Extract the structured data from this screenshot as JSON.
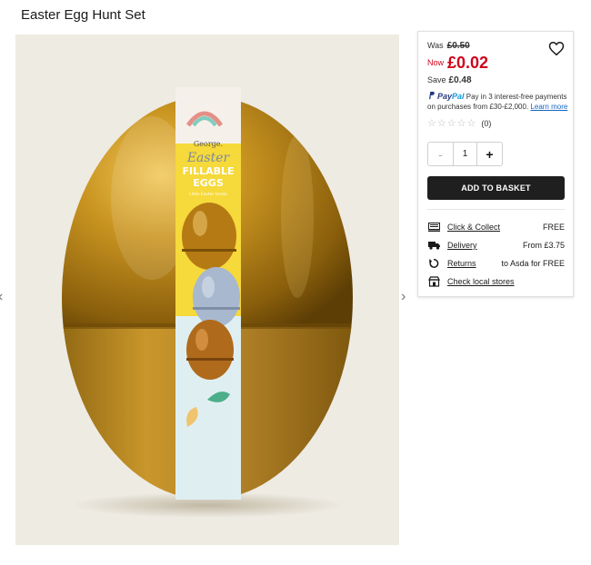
{
  "product": {
    "title": "Easter Egg Hunt Set",
    "image_alt": "Easter Egg Hunt Set",
    "packaging": {
      "brand": "George.",
      "line1": "Easter",
      "line2": "FILLABLE",
      "line3": "EGGS",
      "tagline": "Little Easter treats"
    }
  },
  "gallery": {
    "prev_icon": "chevron-left-icon",
    "next_icon": "chevron-right-icon"
  },
  "pricing": {
    "was_label": "Was",
    "was_price": "£0.50",
    "now_label": "Now",
    "now_price": "£0.02",
    "save_label": "Save",
    "save_amount": "£0.48",
    "now_color": "#d0021b"
  },
  "favourite": {
    "icon": "heart-icon"
  },
  "paypal": {
    "logo_part1": "Pay",
    "logo_part2": "Pal",
    "text": "Pay in 3 interest-free payments on purchases from £30-£2,000.",
    "link": "Learn more"
  },
  "rating": {
    "stars": 0,
    "max": 5,
    "count": "(0)"
  },
  "quantity": {
    "minus": "-",
    "value": "1",
    "plus": "+"
  },
  "basket_button": "ADD TO BASKET",
  "fulfilment": [
    {
      "icon": "store-icon",
      "label": "Click & Collect",
      "value": "FREE"
    },
    {
      "icon": "truck-icon",
      "label": "Delivery",
      "value": "From £3.75"
    },
    {
      "icon": "return-icon",
      "label": "Returns",
      "value": "to Asda for FREE"
    },
    {
      "icon": "shop-icon",
      "label": "Check local stores",
      "value": ""
    }
  ]
}
